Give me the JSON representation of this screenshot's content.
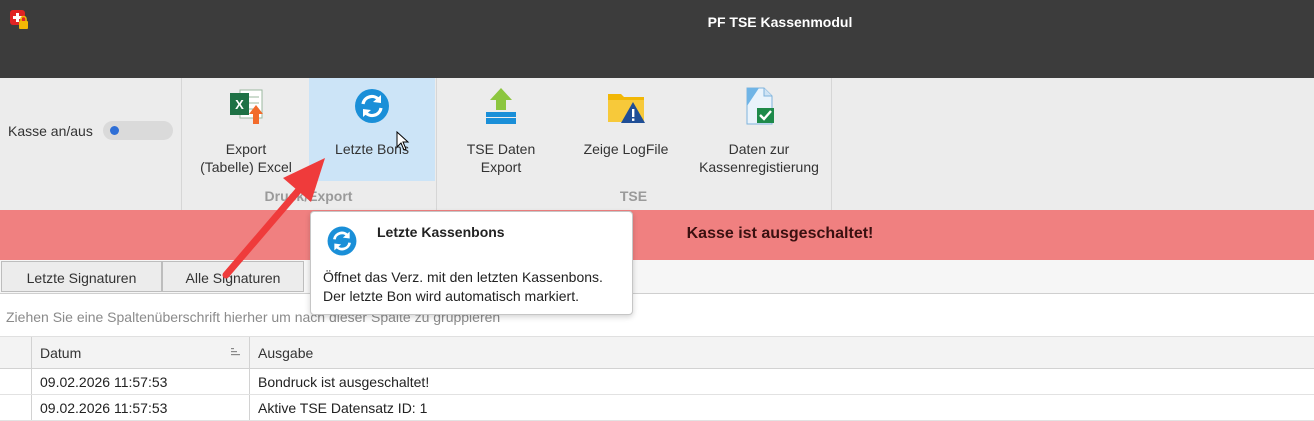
{
  "window": {
    "title": "PF TSE Kassenmodul",
    "app_icon": "swiss-cross-lock-icon"
  },
  "ribbon": {
    "toggle_label": "Kasse an/aus",
    "buttons": [
      {
        "label": "Export\n(Tabelle) Excel",
        "icon": "excel-export-icon"
      },
      {
        "label": "Letzte Bons",
        "icon": "refresh-circle-icon"
      },
      {
        "label": "TSE Daten\nExport",
        "icon": "upload-arrow-icon"
      },
      {
        "label": "Zeige LogFile",
        "icon": "folder-warning-icon"
      },
      {
        "label": "Daten zur\nKassenregistierung",
        "icon": "document-check-icon"
      }
    ],
    "groups": [
      "Druck/Export",
      "TSE"
    ]
  },
  "status": {
    "text": "Kasse ist ausgeschaltet!",
    "color": "#f08080"
  },
  "tabs": [
    "Letzte Signaturen",
    "Alle Signaturen"
  ],
  "grid": {
    "group_hint": "Ziehen Sie eine Spaltenüberschrift hierher um nach dieser Spalte zu gruppieren",
    "columns": [
      "Datum",
      "Ausgabe"
    ],
    "rows": [
      {
        "datum": "09.02.2026 11:57:53",
        "ausgabe": "Bondruck ist ausgeschaltet!"
      },
      {
        "datum": "09.02.2026 11:57:53",
        "ausgabe": "Aktive TSE Datensatz ID: 1"
      }
    ]
  },
  "tooltip": {
    "title": "Letzte Kassenbons",
    "body": "Öffnet das Verz. mit den letzten Kassenbons.\nDer letzte Bon wird automatisch markiert."
  },
  "colors": {
    "titlebar": "#3c3c3c",
    "ribbon": "#ececec",
    "hover": "#cce4f7",
    "arrow": "#ef3b3b",
    "accent": "#1a8fd8"
  }
}
